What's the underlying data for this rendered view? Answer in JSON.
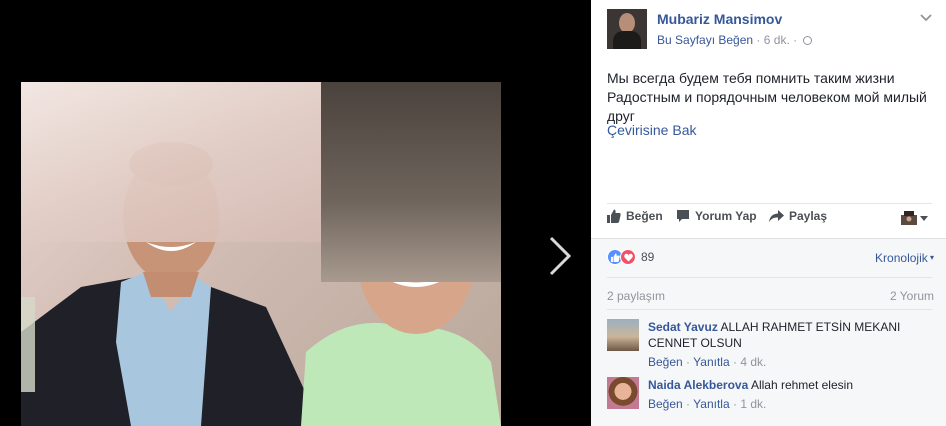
{
  "post": {
    "author": "Mubariz Mansimov",
    "like_page": "Bu Sayfayı Beğen",
    "time": "6 dk.",
    "text": "Мы всегда будем тебя помнить таким жизни Радостным и порядочным человеком мой милый друг",
    "translate": "Çevirisine Bak"
  },
  "actions": {
    "like": "Beğen",
    "comment": "Yorum Yap",
    "share": "Paylaş"
  },
  "stats": {
    "reactions_count": "89",
    "order": "Kronolojik",
    "shares": "2 paylaşım",
    "comments": "2 Yorum"
  },
  "comments": [
    {
      "name": "Sedat Yavuz",
      "text": "ALLAH RAHMET ETSİN MEKANI CENNET OLSUN",
      "like": "Beğen",
      "reply": "Yanıtla",
      "time": "4 dk."
    },
    {
      "name": "Naida Alekberova",
      "text": "Allah rehmet elesin",
      "like": "Beğen",
      "reply": "Yanıtla",
      "time": "1 dk."
    }
  ],
  "colors": {
    "link": "#365899",
    "meta": "#90949c",
    "like_reaction": "#5890ff",
    "love_reaction": "#f25268"
  },
  "icons": {
    "next": "chevron-right-icon",
    "options": "chevron-down-icon",
    "privacy": "globe-icon",
    "like": "thumbs-up-icon",
    "comment": "speech-bubble-icon",
    "share": "share-arrow-icon"
  }
}
